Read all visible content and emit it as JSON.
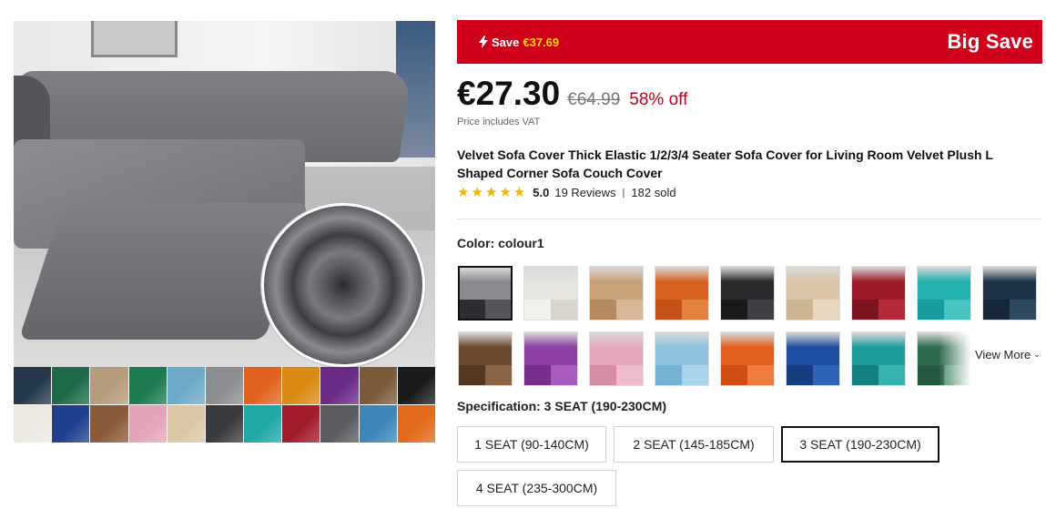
{
  "banner": {
    "save_prefix": "Save",
    "save_amount": "€37.69",
    "big_save": "Big Save",
    "bg_color": "#d0011b",
    "amount_color": "#ffd400"
  },
  "price": {
    "current": "€27.30",
    "original": "€64.99",
    "discount": "58% off",
    "vat_note": "Price includes VAT"
  },
  "product": {
    "title": "Velvet Sofa Cover Thick Elastic 1/2/3/4 Seater Sofa Cover for Living Room Velvet Plush L Shaped Corner Sofa Couch Cover",
    "rating": "5.0",
    "reviews": "19 Reviews",
    "sold": "182 sold",
    "stars": 5
  },
  "color": {
    "label": "Color: colour1",
    "view_more": "View More",
    "variants": [
      {
        "name": "colour1",
        "top": "#8a8b8f",
        "bl": "#2d2e33",
        "br": "#55565b",
        "selected": true
      },
      {
        "name": "colour2",
        "top": "#e6e4df",
        "bl": "#f2f0ea",
        "br": "#d8d5cd"
      },
      {
        "name": "colour3",
        "top": "#c9a27a",
        "bl": "#b58a60",
        "br": "#d7b896"
      },
      {
        "name": "colour4",
        "top": "#d8631f",
        "bl": "#c4501a",
        "br": "#e3823f"
      },
      {
        "name": "colour5",
        "top": "#2a2a2d",
        "bl": "#1a1a1c",
        "br": "#404044"
      },
      {
        "name": "colour6",
        "top": "#d9c6a8",
        "bl": "#cdb792",
        "br": "#e6d8c0"
      },
      {
        "name": "colour7",
        "top": "#9d1b2a",
        "bl": "#7d1220",
        "br": "#b52a3b"
      },
      {
        "name": "colour8",
        "top": "#23b0b0",
        "bl": "#179c9e",
        "br": "#47c4c2"
      },
      {
        "name": "colour9",
        "top": "#1f3547",
        "bl": "#162838",
        "br": "#2f4a5f"
      },
      {
        "name": "colour10",
        "top": "#6b4a2f",
        "bl": "#553822",
        "br": "#8a6444"
      },
      {
        "name": "colour11",
        "top": "#8e3fa3",
        "bl": "#74308a",
        "br": "#a85cbd"
      },
      {
        "name": "colour12",
        "top": "#e3a6bb",
        "bl": "#d68da6",
        "br": "#ecbccc"
      },
      {
        "name": "colour13",
        "top": "#8fc3e0",
        "bl": "#76b2d4",
        "br": "#a9d3ea"
      },
      {
        "name": "colour14",
        "top": "#e2601f",
        "bl": "#cf4c12",
        "br": "#ee7d3d"
      },
      {
        "name": "colour15",
        "top": "#1e4fa0",
        "bl": "#163d80",
        "br": "#2f63b8"
      },
      {
        "name": "colour16",
        "top": "#1f9c9c",
        "bl": "#168080",
        "br": "#36b3b1"
      },
      {
        "name": "colour17",
        "top": "#2e6b4e",
        "bl": "#24573f",
        "br": "#4a8a6a",
        "faded": true
      }
    ]
  },
  "main_image_swatches": [
    "#24384a",
    "#1e6b4a",
    "#b59c7c",
    "#1d7a4f",
    "#6fa9c9",
    "#8d8e92",
    "#e0621e",
    "#d88a12",
    "#6a2a87",
    "#7b5a3c",
    "#1b1b1d",
    "#ece9e3",
    "#1f3f8f",
    "#8a5a3a",
    "#e2a4b8",
    "#d9c7a6",
    "#3a3b3f",
    "#1fa8a6",
    "#a11b2c",
    "#5a5b60",
    "#3d87b8",
    "#e06a1a"
  ],
  "specification": {
    "label": "Specification: 3 SEAT (190-230CM)",
    "options": [
      {
        "label": "1 SEAT (90-140CM)",
        "selected": false
      },
      {
        "label": "2 SEAT (145-185CM)",
        "selected": false
      },
      {
        "label": "3 SEAT (190-230CM)",
        "selected": true
      },
      {
        "label": "4 SEAT (235-300CM)",
        "selected": false
      }
    ]
  }
}
